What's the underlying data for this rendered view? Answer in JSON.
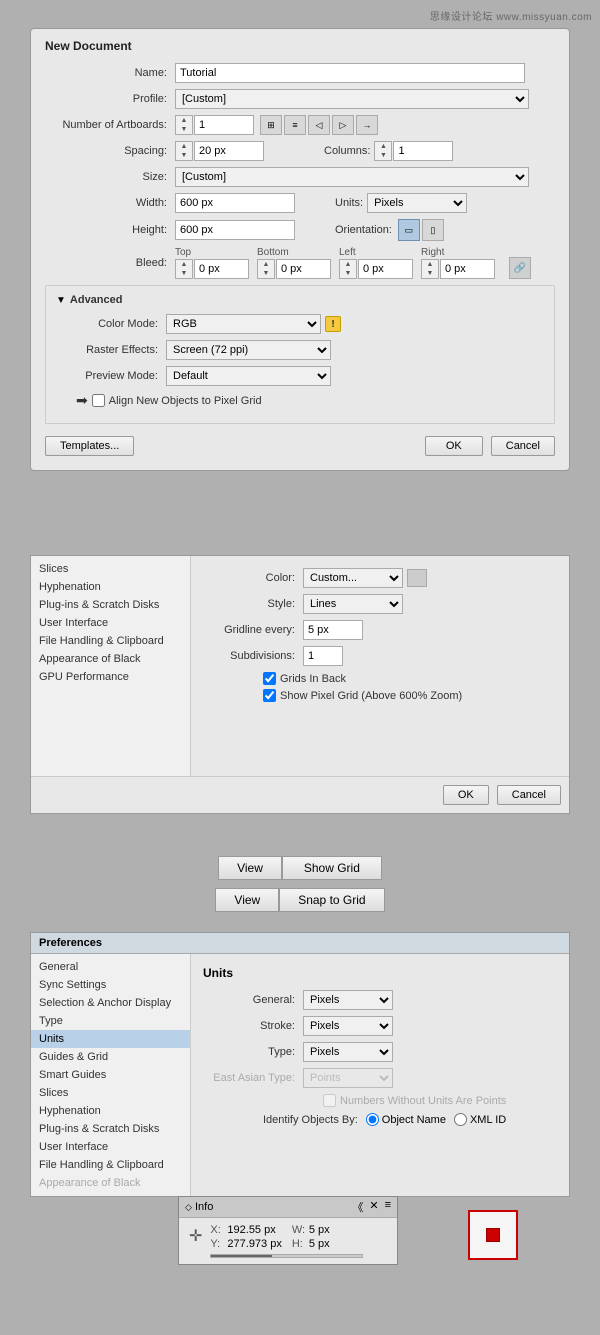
{
  "watermark": "思缘设计论坛  www.missyuan.com",
  "newDocDialog": {
    "title": "New Document",
    "name_label": "Name:",
    "name_value": "Tutorial",
    "profile_label": "Profile:",
    "profile_value": "[Custom]",
    "artboards_label": "Number of Artboards:",
    "artboards_value": "1",
    "spacing_label": "Spacing:",
    "spacing_value": "20 px",
    "columns_label": "Columns:",
    "columns_value": "1",
    "size_label": "Size:",
    "size_value": "[Custom]",
    "width_label": "Width:",
    "width_value": "600 px",
    "units_label": "Units:",
    "units_value": "Pixels",
    "height_label": "Height:",
    "height_value": "600 px",
    "orientation_label": "Orientation:",
    "bleed_label": "Bleed:",
    "bleed_top_label": "Top",
    "bleed_bottom_label": "Bottom",
    "bleed_left_label": "Left",
    "bleed_right_label": "Right",
    "bleed_top_value": "0 px",
    "bleed_bottom_value": "0 px",
    "bleed_left_value": "0 px",
    "bleed_right_value": "0 px",
    "advanced_label": "Advanced",
    "color_mode_label": "Color Mode:",
    "color_mode_value": "RGB",
    "raster_effects_label": "Raster Effects:",
    "raster_effects_value": "Screen (72 ppi)",
    "preview_mode_label": "Preview Mode:",
    "preview_mode_value": "Default",
    "align_checkbox_label": "Align New Objects to Pixel Grid",
    "templates_btn": "Templates...",
    "ok_btn": "OK",
    "cancel_btn": "Cancel"
  },
  "gridPrefs": {
    "color_label": "Color:",
    "color_value": "Custom...",
    "style_label": "Style:",
    "style_value": "Lines",
    "gridline_label": "Gridline every:",
    "gridline_value": "5 px",
    "subdivisions_label": "Subdivisions:",
    "subdivisions_value": "1",
    "grids_in_back": "Grids In Back",
    "show_pixel_grid": "Show Pixel Grid (Above 600% Zoom)",
    "ok_btn": "OK",
    "cancel_btn": "Cancel",
    "sidebar_items": [
      "Slices",
      "Hyphenation",
      "Plug-ins & Scratch Disks",
      "User Interface",
      "File Handling & Clipboard",
      "Appearance of Black",
      "GPU Performance"
    ]
  },
  "viewButtons": [
    {
      "row": 1,
      "view_label": "View",
      "action_label": "Show Grid"
    },
    {
      "row": 2,
      "view_label": "View",
      "action_label": "Snap to Grid"
    }
  ],
  "unitsPrefs": {
    "title": "Preferences",
    "panel_title": "Units",
    "general_label": "General:",
    "general_value": "Pixels",
    "stroke_label": "Stroke:",
    "stroke_value": "Pixels",
    "type_label": "Type:",
    "type_value": "Pixels",
    "east_asian_label": "East Asian Type:",
    "east_asian_value": "Points",
    "numbers_no_units": "Numbers Without Units Are Points",
    "identify_label": "Identify Objects By:",
    "object_name": "Object Name",
    "xml_id": "XML ID",
    "sidebar_items": [
      "General",
      "Sync Settings",
      "Selection & Anchor Display",
      "Type",
      "Units",
      "Guides & Grid",
      "Smart Guides",
      "Slices",
      "Hyphenation",
      "Plug-ins & Scratch Disks",
      "User Interface",
      "File Handling & Clipboard",
      "Appearance of Black"
    ],
    "active_item": "Units"
  },
  "infoPanel": {
    "title": "Info",
    "x_label": "X:",
    "x_value": "192.55 px",
    "y_label": "Y:",
    "y_value": "277.973 px",
    "w_label": "W:",
    "w_value": "5 px",
    "h_label": "H:",
    "h_value": "5 px"
  }
}
